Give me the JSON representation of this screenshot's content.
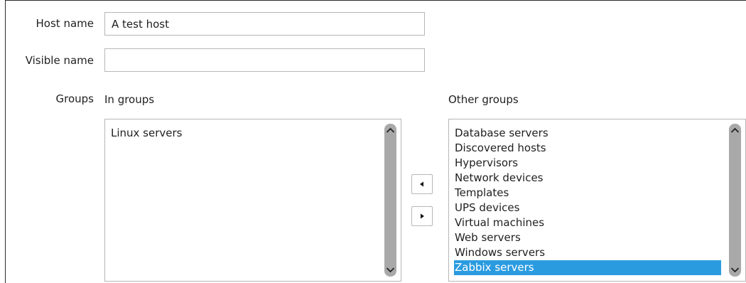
{
  "form": {
    "host_name": {
      "label": "Host name",
      "value": "A test host"
    },
    "visible_name": {
      "label": "Visible name",
      "value": ""
    },
    "groups": {
      "label": "Groups",
      "in_groups_title": "In groups",
      "other_groups_title": "Other groups",
      "in_groups": [
        "Linux servers"
      ],
      "other_groups": [
        "Database servers",
        "Discovered hosts",
        "Hypervisors",
        "Network devices",
        "Templates",
        "UPS devices",
        "Virtual machines",
        "Web servers",
        "Windows servers",
        "Zabbix servers"
      ],
      "selected_other_group": "Zabbix servers"
    }
  },
  "buttons": {
    "move_left_icon": "triangle-left-icon",
    "move_right_icon": "triangle-right-icon"
  },
  "colors": {
    "selection": "#2b9be0",
    "scrollbar": "#a9a9a9",
    "border": "#b7b7b7"
  }
}
